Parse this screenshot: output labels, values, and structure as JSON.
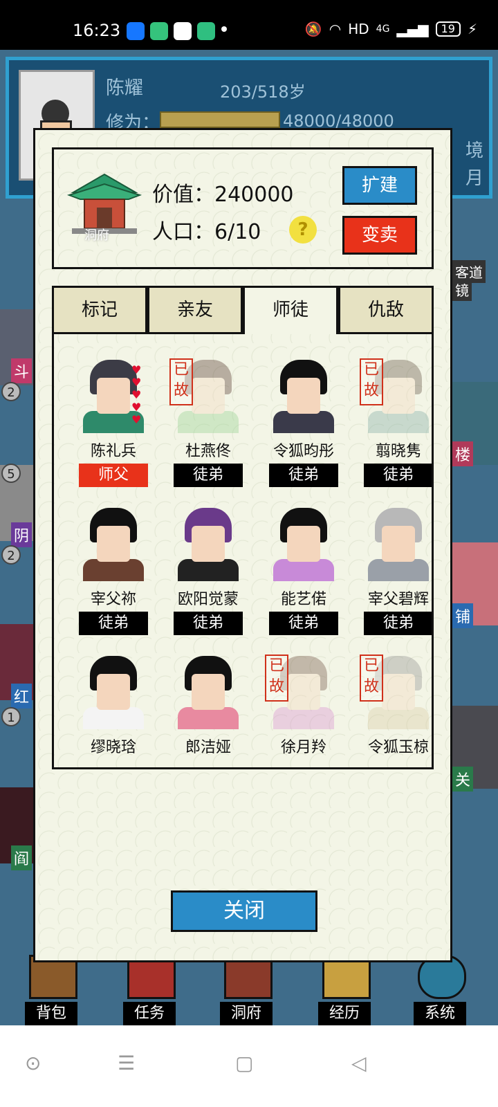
{
  "status_bar": {
    "time": "16:23",
    "network": "HD",
    "battery": "19",
    "signal": "4G"
  },
  "background": {
    "player_name": "陈耀",
    "age": "203/518岁",
    "xiuwei_label": "修为：",
    "xiuwei_value": "48000/48000",
    "right_edge_texts": [
      "境",
      "月"
    ],
    "side_badges": [
      "2",
      "5",
      "2",
      "1"
    ],
    "side_tags": [
      "斗",
      "阴",
      "红",
      "阎"
    ],
    "right_tags": [
      "客道",
      "镜",
      "楼",
      "铺",
      "关"
    ]
  },
  "toolbar": {
    "items": [
      {
        "label": "背包",
        "icon": "backpack-icon"
      },
      {
        "label": "任务",
        "icon": "scroll-icon"
      },
      {
        "label": "洞府",
        "icon": "pavilion-icon"
      },
      {
        "label": "经历",
        "icon": "book-icon"
      },
      {
        "label": "系统",
        "icon": "gear-icon"
      }
    ]
  },
  "modal": {
    "house_label": "洞府",
    "value_text": "价值：240000",
    "population_text": "人口：6/10",
    "help_symbol": "?",
    "expand_label": "扩建",
    "sell_label": "变卖",
    "tabs": [
      {
        "label": "标记",
        "active": false
      },
      {
        "label": "亲友",
        "active": false
      },
      {
        "label": "师徒",
        "active": true
      },
      {
        "label": "仇敌",
        "active": false
      }
    ],
    "dead_stamp": "已故",
    "close_label": "关闭",
    "people": [
      {
        "name": "陈礼兵",
        "role": "师父",
        "dead": false,
        "hearts": 5,
        "hair": "#3c3c46",
        "cloth": "#2e8a6a"
      },
      {
        "name": "杜燕佟",
        "role": "徒弟",
        "dead": true,
        "hearts": 0,
        "hair": "#4a2a20",
        "cloth": "#8fd08a"
      },
      {
        "name": "令狐昀彤",
        "role": "徒弟",
        "dead": false,
        "hearts": 0,
        "hair": "#111111",
        "cloth": "#3a3a4a"
      },
      {
        "name": "翦晓隽",
        "role": "徒弟",
        "dead": true,
        "hearts": 0,
        "hair": "#5a4a3a",
        "cloth": "#7aa8a0"
      },
      {
        "name": "宰父祢",
        "role": "徒弟",
        "dead": false,
        "hearts": 0,
        "hair": "#111111",
        "cloth": "#6a4030"
      },
      {
        "name": "欧阳觉蒙",
        "role": "徒弟",
        "dead": false,
        "hearts": 0,
        "hair": "#6a3a8a",
        "cloth": "#222222"
      },
      {
        "name": "能艺偌",
        "role": "徒弟",
        "dead": false,
        "hearts": 0,
        "hair": "#111111",
        "cloth": "#c88ad8"
      },
      {
        "name": "宰父碧辉",
        "role": "徒弟",
        "dead": false,
        "hearts": 0,
        "hair": "#b8b8b8",
        "cloth": "#9aa0a8"
      },
      {
        "name": "缪晓琀",
        "role": "",
        "dead": false,
        "hearts": 0,
        "hair": "#111111",
        "cloth": "#f4f4f4"
      },
      {
        "name": "郎洁娅",
        "role": "",
        "dead": false,
        "hearts": 0,
        "hair": "#111111",
        "cloth": "#e88aa0"
      },
      {
        "name": "徐月羚",
        "role": "",
        "dead": true,
        "hearts": 0,
        "hair": "#6a4a3a",
        "cloth": "#d88ad0"
      },
      {
        "name": "令狐玉椋",
        "role": "",
        "dead": true,
        "hearts": 0,
        "hair": "#8a8a8a",
        "cloth": "#d8c8a0"
      }
    ]
  }
}
